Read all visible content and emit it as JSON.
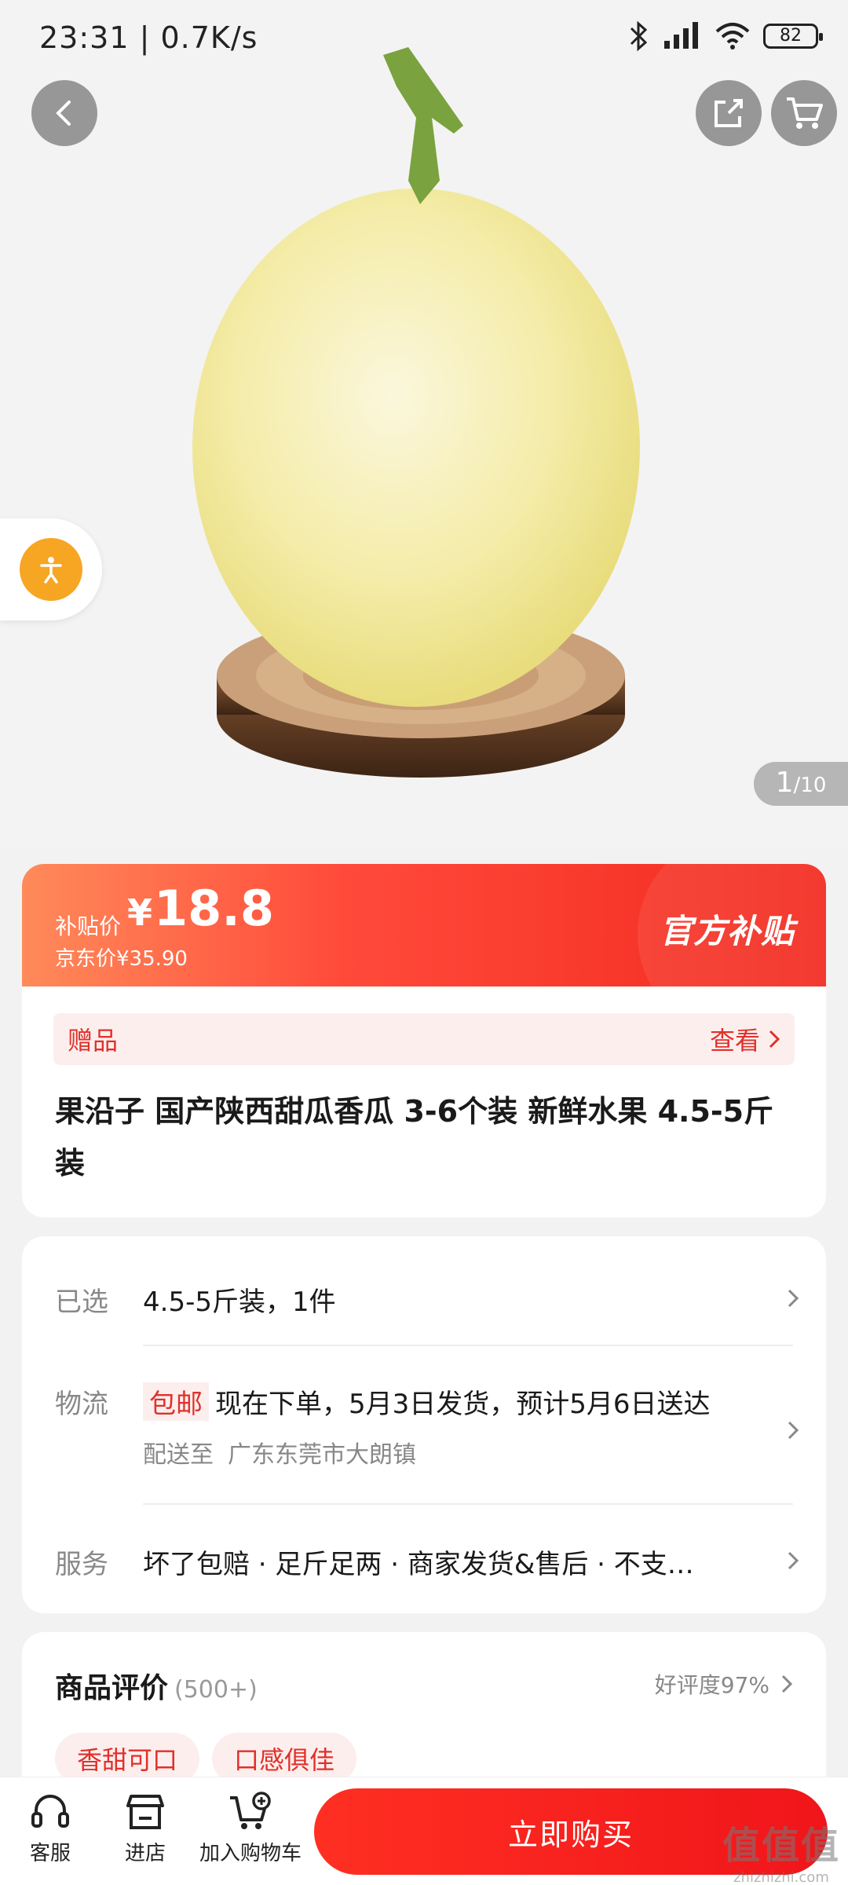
{
  "status_bar": {
    "time": "23:31 | 0.7K/s",
    "battery": "82"
  },
  "gallery": {
    "current": "1",
    "total": "/10"
  },
  "price": {
    "label": "补贴价",
    "currency": "¥",
    "value": "18.8",
    "original": "京东价¥35.90",
    "badge": "官方补贴"
  },
  "gift": {
    "label": "赠品",
    "more": "查看"
  },
  "product": {
    "title": "果沿子 国产陕西甜瓜香瓜 3-6个装 新鲜水果 4.5-5斤装"
  },
  "selection": {
    "label": "已选",
    "value": "4.5-5斤装，1件"
  },
  "logistics": {
    "label": "物流",
    "tag": "包邮",
    "text": "现在下单，5月3日发货，预计5月6日送达",
    "ship_to_label": "配送至",
    "ship_to": "广东东莞市大朗镇"
  },
  "service": {
    "label": "服务",
    "text": "坏了包赔 · 足斤足两 · 商家发货&售后 · 不支…"
  },
  "reviews": {
    "title": "商品评价",
    "count": "(500+)",
    "rate": "好评度97%",
    "tags": [
      "香甜可口",
      "口感俱佳"
    ]
  },
  "bottom_bar": {
    "service": "客服",
    "store": "进店",
    "add_cart": "加入购物车",
    "buy": "立即购买"
  },
  "watermark": {
    "big": "值值值",
    "small": "zhizhizhi.com"
  }
}
